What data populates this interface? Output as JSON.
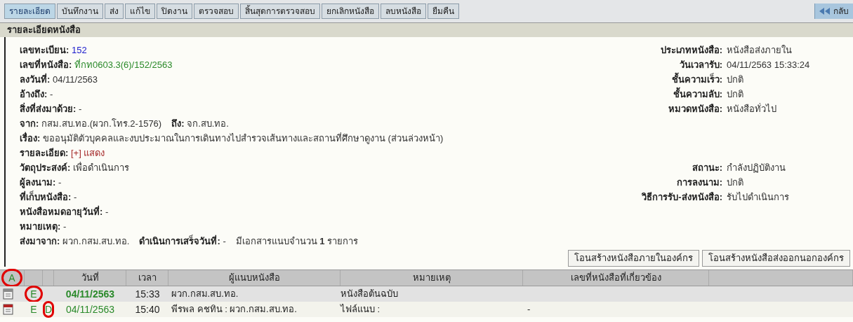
{
  "tabs": [
    {
      "label": "รายละเอียด",
      "selected": true
    },
    {
      "label": "บันทึกงาน",
      "selected": false
    },
    {
      "label": "ส่ง",
      "selected": false
    },
    {
      "label": "แก้ไข",
      "selected": false
    },
    {
      "label": "ปิดงาน",
      "selected": false
    },
    {
      "label": "ตรวจสอบ",
      "selected": false
    },
    {
      "label": "สิ้นสุดการตรวจสอบ",
      "selected": false
    },
    {
      "label": "ยกเลิกหนังสือ",
      "selected": false
    },
    {
      "label": "ลบหนังสือ",
      "selected": false
    },
    {
      "label": "ยืมคืน",
      "selected": false
    }
  ],
  "back_button": {
    "label": "กลับ"
  },
  "section_title": "รายละเอียดหนังสือ",
  "detail_rows": [
    {
      "left": [
        {
          "label": "เลขทะเบียน:",
          "value": "152",
          "kind": "number"
        }
      ],
      "right": {
        "label": "ประเภทหนังสือ:",
        "value": "หนังสือส่งภายใน"
      }
    },
    {
      "left": [
        {
          "label": "เลขที่หนังสือ:",
          "value": "ที่กท0603.3(6)/152/2563",
          "kind": "code"
        }
      ],
      "right": {
        "label": "วันเวลารับ:",
        "value": "04/11/2563  15:33:24"
      }
    },
    {
      "left": [
        {
          "label": "ลงวันที่:",
          "value": "04/11/2563",
          "kind": "plain"
        }
      ],
      "right": {
        "label": "ชั้นความเร็ว:",
        "value": "ปกติ"
      }
    },
    {
      "left": [
        {
          "label": "อ้างถึง:",
          "value": "-",
          "kind": "plain"
        }
      ],
      "right": {
        "label": "ชั้นความลับ:",
        "value": "ปกติ"
      }
    },
    {
      "left": [
        {
          "label": "สิ่งที่ส่งมาด้วย:",
          "value": "-",
          "kind": "plain"
        }
      ],
      "right": {
        "label": "หมวดหนังสือ:",
        "value": "หนังสือทั่วไป"
      }
    },
    {
      "left": [
        {
          "label": "จาก:",
          "value": "กสม.สบ.ทอ.(ผวก.โทร.2-1576)",
          "kind": "plain"
        },
        {
          "label": "ถึง:",
          "value": "จก.สบ.ทอ.",
          "kind": "plain"
        }
      ]
    },
    {
      "left": [
        {
          "label": "เรื่อง:",
          "value": "ขออนุมัติตัวบุคคลและงบประมาณในการเดินทางไปสำรวจเส้นทางและสถานที่ศึกษาดูงาน (ส่วนล่วงหน้า)",
          "kind": "plain"
        }
      ]
    },
    {
      "left": [
        {
          "label": "รายละเอียด:",
          "value": "[+] แสดง",
          "kind": "toggle"
        }
      ]
    },
    {
      "left": [
        {
          "label": "วัตถุประสงค์:",
          "value": "เพื่อดำเนินการ",
          "kind": "plain"
        }
      ],
      "right": {
        "label": "สถานะ:",
        "value": "กำลังปฏิบัติงาน"
      }
    },
    {
      "left": [
        {
          "label": "ผู้ลงนาม:",
          "value": "-",
          "kind": "plain"
        }
      ],
      "right": {
        "label": "การลงนาม:",
        "value": "ปกติ"
      }
    },
    {
      "left": [
        {
          "label": "ที่เก็บหนังสือ:",
          "value": "-",
          "kind": "plain"
        }
      ],
      "right": {
        "label": "วิธีการรับ-ส่งหนังสือ:",
        "value": "รับไปดำเนินการ"
      }
    },
    {
      "left": [
        {
          "label": "หนังสือหมดอายุวันที่:",
          "value": "-",
          "kind": "plain"
        }
      ]
    },
    {
      "left": [
        {
          "label": "หมายเหตุ:",
          "value": "-",
          "kind": "plain"
        }
      ]
    },
    {
      "left": [
        {
          "label": "ส่งมาจาก:",
          "value": "ผวก.กสม.สบ.ทอ.",
          "kind": "plain"
        },
        {
          "label": "ดำเนินการเสร็จวันที่:",
          "value": "-",
          "kind": "plain"
        },
        {
          "value": "มีเอกสารแนบจำนวน **1** รายการ",
          "kind": "plain"
        }
      ]
    }
  ],
  "action_buttons": [
    "โอนสร้างหนังสือภายในองค์กร",
    "โอนสร้างหนังสือส่งออกนอกองค์กร"
  ],
  "table": {
    "columns": [
      {
        "kind": "annotation",
        "annotation": "A"
      },
      {
        "kind": "blank"
      },
      {
        "kind": "blank"
      },
      {
        "kind": "text",
        "label": "วันที่"
      },
      {
        "kind": "text",
        "label": "เวลา"
      },
      {
        "kind": "text",
        "label": "ผู้แนบหนังสือ"
      },
      {
        "kind": "text",
        "label": "หมายเหตุ"
      },
      {
        "kind": "text",
        "label": "เลขที่หนังสือที่เกี่ยวข้อง"
      },
      {
        "kind": "blank"
      }
    ],
    "rows": [
      {
        "highlighted": true,
        "kind": "file",
        "mark_1": {
          "text": "E",
          "circled": true
        },
        "date": "04/11/2563",
        "time": "15:33",
        "attached_by": "ผวก.กสม.สบ.ทอ.",
        "note": "หนังสือต้นฉบับ"
      },
      {
        "highlighted": false,
        "kind": "pdf",
        "mark_1": {
          "text": "E",
          "circled": false
        },
        "mark_2": {
          "text": "D",
          "circled": true
        },
        "date": "04/11/2563",
        "time": "15:40",
        "attached_by": "พีรพล คชทิน : ผวก.กสม.สบ.ทอ.",
        "note": "ไฟล์แนบ :",
        "related": "-"
      }
    ]
  }
}
